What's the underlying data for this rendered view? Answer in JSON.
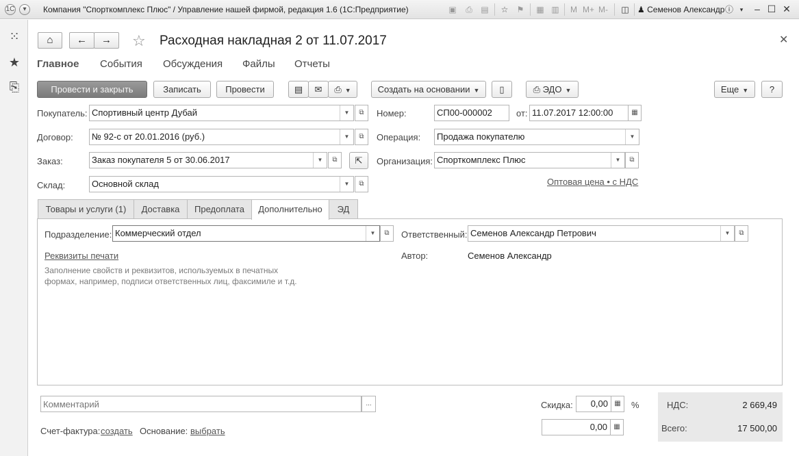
{
  "app": {
    "window_title": "Компания \"Спорткомплекс Плюс\" / Управление нашей фирмой, редакция 1.6  (1С:Предприятие)",
    "user_name": "Семенов Александр",
    "memory_buttons": [
      "M",
      "M+",
      "M-"
    ]
  },
  "document": {
    "title": "Расходная накладная 2 от 11.07.2017"
  },
  "form_tabs": [
    {
      "label": "Главное"
    },
    {
      "label": "События"
    },
    {
      "label": "Обсуждения"
    },
    {
      "label": "Файлы"
    },
    {
      "label": "Отчеты"
    }
  ],
  "toolbar": {
    "post_close": "Провести и закрыть",
    "save": "Записать",
    "post": "Провести",
    "create_based": "Создать на основании",
    "edo": "ЭДО",
    "more": "Еще",
    "help": "?"
  },
  "header_fields": {
    "buyer_label": "Покупатель:",
    "buyer_value": "Спортивный центр Дубай",
    "contract_label": "Договор:",
    "contract_value": "№ 92-с от 20.01.2016 (руб.)",
    "order_label": "Заказ:",
    "order_value": "Заказ покупателя 5 от 30.06.2017",
    "warehouse_label": "Склад:",
    "warehouse_value": "Основной склад",
    "number_label": "Номер:",
    "number_value": "СП00-000002",
    "date_label": "от:",
    "date_value": "11.07.2017 12:00:00",
    "operation_label": "Операция:",
    "operation_value": "Продажа покупателю",
    "org_label": "Организация:",
    "org_value": "Спорткомплекс Плюс",
    "price_link": "Оптовая цена • с НДС"
  },
  "inner_tabs": [
    {
      "label": "Товары и услуги (1)"
    },
    {
      "label": "Доставка"
    },
    {
      "label": "Предоплата"
    },
    {
      "label": "Дополнительно"
    },
    {
      "label": "ЭД"
    }
  ],
  "additional_tab": {
    "division_label": "Подразделение:",
    "division_value": "Коммерческий отдел",
    "responsible_label": "Ответственный:",
    "responsible_value": "Семенов Александр Петрович",
    "print_req_link": "Реквизиты печати",
    "author_label": "Автор:",
    "author_value": "Семенов Александр",
    "hint_line1": "Заполнение свойств и реквизитов, используемых в печатных",
    "hint_line2": "формах, например, подписи ответственных лиц, факсимиле и т.д."
  },
  "footer": {
    "comment_placeholder": "Комментарий",
    "comment_more": "...",
    "invoice_label": "Счет-фактура:",
    "invoice_link": "создать",
    "basis_label": "Основание:",
    "basis_link": "выбрать",
    "discount_label": "Скидка:",
    "discount_value": "0,00",
    "discount_unit": "%",
    "amount_value": "0,00",
    "vat_label": "НДС:",
    "vat_value": "2 669,49",
    "total_label": "Всего:",
    "total_value": "17 500,00"
  }
}
